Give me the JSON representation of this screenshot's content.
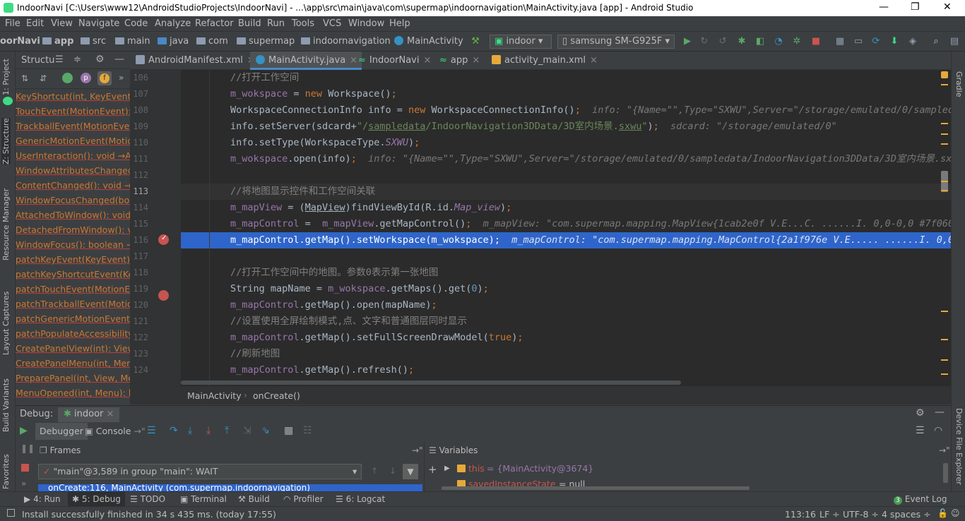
{
  "window": {
    "title": "IndoorNavi [C:\\Users\\www12\\AndroidStudioProjects\\IndoorNavi] - ...\\app\\src\\main\\java\\com\\supermap\\indoornavigation\\MainActivity.java [app] - Android Studio",
    "minimize": "—",
    "restore": "❐",
    "close": "✕"
  },
  "menu": [
    "File",
    "Edit",
    "View",
    "Navigate",
    "Code",
    "Analyze",
    "Refactor",
    "Build",
    "Run",
    "Tools",
    "VCS",
    "Window",
    "Help"
  ],
  "breadcrumb": [
    "oorNavi",
    "app",
    "src",
    "main",
    "java",
    "com",
    "supermap",
    "indoornavigation",
    "MainActivity"
  ],
  "toolbar": {
    "run_config": "indoor",
    "device": "samsung SM-G925F"
  },
  "left_strip": [
    "1: Project",
    "Z: Structure",
    "Resource Manager",
    "Layout Captures",
    "Build Variants",
    "Favorites"
  ],
  "right_strip": [
    "Gradle",
    "Device File Explorer"
  ],
  "structure": {
    "title": "Structu",
    "items": [
      "KeyShortcut(int, KeyEvent): b",
      "TouchEvent(MotionEvent): b",
      "TrackballEvent(MotionEvent",
      "GenericMotionEvent(MotionE",
      "UserInteraction(): void →Act",
      "WindowAttributesChanged(L",
      "ContentChanged(): void →Ac",
      "WindowFocusChanged(bool",
      "AttachedToWindow(): void →",
      "DetachedFromWindow(): voi",
      "WindowFocus(): boolean →",
      "patchKeyEvent(KeyEvent): b",
      "patchKeyShortcutEvent(KeyE",
      "patchTouchEvent(MotionEve",
      "patchTrackballEvent(Motion",
      "patchGenericMotionEvent(M",
      "patchPopulateAccessibilityE",
      "CreatePanelView(int): View →",
      "CreatePanelMenu(int, Menu)",
      "PreparePanel(int, View, Men",
      "MenuOpened(int, Menu): bo"
    ]
  },
  "tabs": [
    {
      "label": "AndroidManifest.xml",
      "active": false
    },
    {
      "label": "MainActivity.java",
      "active": true
    },
    {
      "label": "IndoorNavi",
      "active": false
    },
    {
      "label": "app",
      "active": false
    },
    {
      "label": "activity_main.xml",
      "active": false
    }
  ],
  "editor": {
    "line_numbers": [
      "106",
      "107",
      "108",
      "109",
      "110",
      "111",
      "112",
      "113",
      "114",
      "115",
      "116",
      "117",
      "118",
      "119",
      "120",
      "121",
      "122",
      "123",
      "124"
    ],
    "breadcrumb": [
      "MainActivity",
      "onCreate()"
    ]
  },
  "debug": {
    "label": "Debug:",
    "config": "indoor",
    "tabs": [
      "Debugger",
      "Console"
    ],
    "frames_title": "Frames",
    "thread": "\"main\"@3,589 in group \"main\": WAIT",
    "frame_row": "onCreate:116, MainActivity (com.supermap.indoornavigation)",
    "variables_title": "Variables",
    "vars": [
      {
        "name": "this",
        "value": "= {MainActivity@3674}"
      },
      {
        "name": "savedInstanceState",
        "value": "= null"
      }
    ]
  },
  "bottom_tabs": [
    "4: Run",
    "5: Debug",
    "TODO",
    "Terminal",
    "Build",
    "Profiler",
    "6: Logcat",
    "Event Log"
  ],
  "status": {
    "message": "Install successfully finished in 34 s 435 ms. (today 17:55)",
    "position": "113:16",
    "line_sep": "LF",
    "encoding": "UTF-8",
    "indent": "4 spaces"
  },
  "colors": {
    "accent": "#4a88c7",
    "selection": "#2f65ca",
    "keyword": "#cc7832",
    "string": "#6a8759",
    "field": "#9876aa",
    "comment": "#808080",
    "editor_bg": "#2b2b2b"
  }
}
